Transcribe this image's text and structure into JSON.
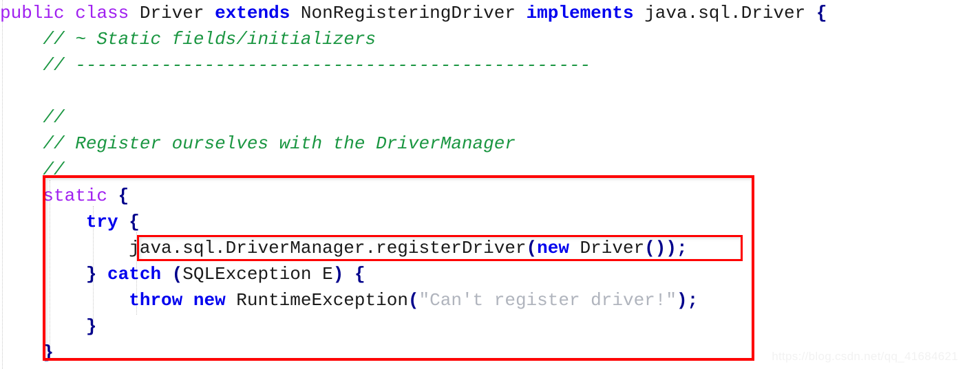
{
  "editor": {
    "language": "java",
    "background": "#ffffff",
    "font_size_px": 26,
    "line_height_px": 38,
    "colors": {
      "keyword_purple": "#a020f0",
      "keyword_blue": "#0000ee",
      "comment_green": "#1a9641",
      "string_gray": "#b0b4bd",
      "punctuation_navy": "#00008b",
      "plain_text": "#1a1a1a",
      "annotation_red": "#fe0000",
      "watermark_gray": "#f2f2f2"
    },
    "lines": [
      {
        "index": 1,
        "indent": "",
        "text": "public class Driver extends NonRegisteringDriver implements java.sql.Driver {",
        "tokens": [
          {
            "t": "public",
            "c": "tk-keyword"
          },
          {
            "t": " ",
            "c": "tk-plain"
          },
          {
            "t": "class",
            "c": "tk-keyword"
          },
          {
            "t": " Driver ",
            "c": "tk-plain"
          },
          {
            "t": "extends",
            "c": "tk-kw2"
          },
          {
            "t": " NonRegisteringDriver ",
            "c": "tk-plain"
          },
          {
            "t": "implements",
            "c": "tk-kw2"
          },
          {
            "t": " java.sql.Driver ",
            "c": "tk-plain"
          },
          {
            "t": "{",
            "c": "tk-punct"
          }
        ]
      },
      {
        "index": 2,
        "indent": "    ",
        "text": "    // ~ Static fields/initializers",
        "tokens": [
          {
            "t": "    ",
            "c": "tk-plain"
          },
          {
            "t": "// ~ Static fields/initializers",
            "c": "tk-comment"
          }
        ]
      },
      {
        "index": 3,
        "indent": "    ",
        "text": "    // ------------------------------------------------",
        "tokens": [
          {
            "t": "    ",
            "c": "tk-plain"
          },
          {
            "t": "// ------------------------------------------------",
            "c": "tk-comment"
          }
        ]
      },
      {
        "index": 4,
        "indent": "",
        "text": "",
        "tokens": []
      },
      {
        "index": 5,
        "indent": "    ",
        "text": "    //",
        "tokens": [
          {
            "t": "    ",
            "c": "tk-plain"
          },
          {
            "t": "//",
            "c": "tk-comment"
          }
        ]
      },
      {
        "index": 6,
        "indent": "    ",
        "text": "    // Register ourselves with the DriverManager",
        "tokens": [
          {
            "t": "    ",
            "c": "tk-plain"
          },
          {
            "t": "// Register ourselves with the DriverManager",
            "c": "tk-comment"
          }
        ]
      },
      {
        "index": 7,
        "indent": "    ",
        "text": "    //",
        "tokens": [
          {
            "t": "    ",
            "c": "tk-plain"
          },
          {
            "t": "//",
            "c": "tk-comment"
          }
        ]
      },
      {
        "index": 8,
        "indent": "    ",
        "text": "    static {",
        "tokens": [
          {
            "t": "    ",
            "c": "tk-plain"
          },
          {
            "t": "static",
            "c": "tk-keyword"
          },
          {
            "t": " ",
            "c": "tk-plain"
          },
          {
            "t": "{",
            "c": "tk-punct"
          }
        ]
      },
      {
        "index": 9,
        "indent": "        ",
        "text": "        try {",
        "tokens": [
          {
            "t": "        ",
            "c": "tk-plain"
          },
          {
            "t": "try",
            "c": "tk-kw2"
          },
          {
            "t": " ",
            "c": "tk-plain"
          },
          {
            "t": "{",
            "c": "tk-punct"
          }
        ]
      },
      {
        "index": 10,
        "indent": "            ",
        "text": "            java.sql.DriverManager.registerDriver(new Driver());",
        "tokens": [
          {
            "t": "            ",
            "c": "tk-plain"
          },
          {
            "t": "java.sql.DriverManager.registerDriver",
            "c": "tk-plain"
          },
          {
            "t": "(",
            "c": "tk-punct"
          },
          {
            "t": "new",
            "c": "tk-kw2"
          },
          {
            "t": " Driver",
            "c": "tk-plain"
          },
          {
            "t": "())",
            "c": "tk-punct"
          },
          {
            "t": ";",
            "c": "tk-punct"
          }
        ]
      },
      {
        "index": 11,
        "indent": "        ",
        "text": "        } catch (SQLException E) {",
        "tokens": [
          {
            "t": "        ",
            "c": "tk-plain"
          },
          {
            "t": "}",
            "c": "tk-punct"
          },
          {
            "t": " ",
            "c": "tk-plain"
          },
          {
            "t": "catch",
            "c": "tk-kw2"
          },
          {
            "t": " ",
            "c": "tk-plain"
          },
          {
            "t": "(",
            "c": "tk-punct"
          },
          {
            "t": "SQLException E",
            "c": "tk-plain"
          },
          {
            "t": ")",
            "c": "tk-punct"
          },
          {
            "t": " ",
            "c": "tk-plain"
          },
          {
            "t": "{",
            "c": "tk-punct"
          }
        ]
      },
      {
        "index": 12,
        "indent": "            ",
        "text": "            throw new RuntimeException(\"Can't register driver!\");",
        "tokens": [
          {
            "t": "            ",
            "c": "tk-plain"
          },
          {
            "t": "throw",
            "c": "tk-kw2"
          },
          {
            "t": " ",
            "c": "tk-plain"
          },
          {
            "t": "new",
            "c": "tk-kw2"
          },
          {
            "t": " RuntimeException",
            "c": "tk-plain"
          },
          {
            "t": "(",
            "c": "tk-punct"
          },
          {
            "t": "\"Can't register driver!\"",
            "c": "tk-string"
          },
          {
            "t": ")",
            "c": "tk-punct"
          },
          {
            "t": ";",
            "c": "tk-punct"
          }
        ]
      },
      {
        "index": 13,
        "indent": "        ",
        "text": "        }",
        "tokens": [
          {
            "t": "        ",
            "c": "tk-plain"
          },
          {
            "t": "}",
            "c": "tk-punct"
          }
        ]
      },
      {
        "index": 14,
        "indent": "    ",
        "text": "    }",
        "tokens": [
          {
            "t": "    ",
            "c": "tk-plain"
          },
          {
            "t": "}",
            "c": "tk-punct"
          }
        ]
      }
    ]
  },
  "annotations": [
    {
      "name": "outer-highlight-box",
      "color": "#fe0000",
      "target": "static initializer block"
    },
    {
      "name": "inner-highlight-box",
      "color": "#fe0000",
      "target": "java.sql.DriverManager.registerDriver(new Driver());"
    }
  ],
  "watermark": {
    "text": "https://blog.csdn.net/qq_41684621"
  }
}
